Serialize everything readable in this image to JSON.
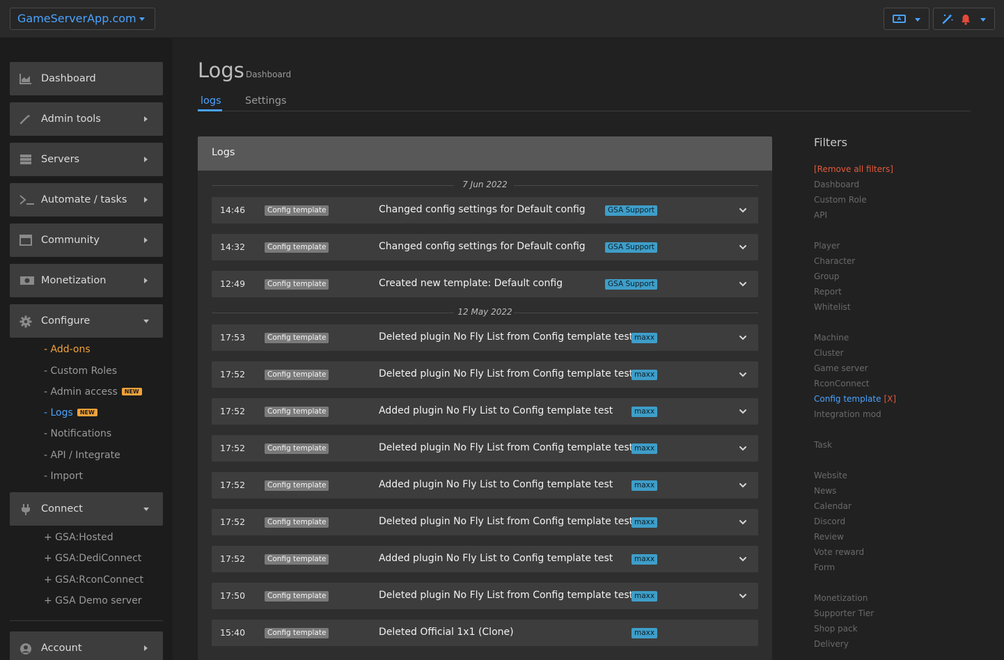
{
  "topbar": {
    "brand": "GameServerApp.com",
    "lang_icon_text": "A",
    "icons": [
      "language-icon",
      "magic-wand-icon",
      "bell-icon"
    ]
  },
  "sidebar": {
    "items": [
      {
        "label": "Dashboard",
        "icon": "chart-icon"
      },
      {
        "label": "Admin tools",
        "icon": "magic-wand-icon"
      },
      {
        "label": "Servers",
        "icon": "server-icon"
      },
      {
        "label": "Automate / tasks",
        "icon": "terminal-icon"
      },
      {
        "label": "Community",
        "icon": "window-icon"
      },
      {
        "label": "Monetization",
        "icon": "money-icon"
      },
      {
        "label": "Configure",
        "icon": "gear-icon"
      },
      {
        "label": "Connect",
        "icon": "plug-icon"
      },
      {
        "label": "Account",
        "icon": "user-icon"
      }
    ],
    "configure_sub": [
      {
        "label": "- Add-ons"
      },
      {
        "label": "- Custom Roles"
      },
      {
        "label": "- Admin access",
        "badge": "NEW"
      },
      {
        "label": "- Logs",
        "badge": "NEW"
      },
      {
        "label": "- Notifications"
      },
      {
        "label": "- API / Integrate"
      },
      {
        "label": "- Import"
      }
    ],
    "connect_sub": [
      {
        "label": "+ GSA:Hosted"
      },
      {
        "label": "+ GSA:DediConnect"
      },
      {
        "label": "+ GSA:RconConnect"
      },
      {
        "label": "+ GSA Demo server"
      }
    ]
  },
  "page": {
    "title": "Logs",
    "subtitle": "Dashboard",
    "tabs": [
      "logs",
      "Settings"
    ]
  },
  "logs": {
    "header": "Logs",
    "dates": [
      "7 Jun 2022",
      "12 May 2022"
    ],
    "rows": [
      {
        "time": "14:46",
        "category": "Config template",
        "message": "Changed config settings for Default config",
        "user": "GSA Support"
      },
      {
        "time": "14:32",
        "category": "Config template",
        "message": "Changed config settings for Default config",
        "user": "GSA Support"
      },
      {
        "time": "12:49",
        "category": "Config template",
        "message": "Created new template: Default config",
        "user": "GSA Support"
      },
      {
        "time": "17:53",
        "category": "Config template",
        "message": "Deleted plugin No Fly List from Config template test",
        "user": "maxx"
      },
      {
        "time": "17:52",
        "category": "Config template",
        "message": "Deleted plugin No Fly List from Config template test",
        "user": "maxx"
      },
      {
        "time": "17:52",
        "category": "Config template",
        "message": "Added plugin No Fly List to Config template test",
        "user": "maxx"
      },
      {
        "time": "17:52",
        "category": "Config template",
        "message": "Deleted plugin No Fly List from Config template test",
        "user": "maxx"
      },
      {
        "time": "17:52",
        "category": "Config template",
        "message": "Added plugin No Fly List to Config template test",
        "user": "maxx"
      },
      {
        "time": "17:52",
        "category": "Config template",
        "message": "Deleted plugin No Fly List from Config template test",
        "user": "maxx"
      },
      {
        "time": "17:52",
        "category": "Config template",
        "message": "Added plugin No Fly List to Config template test",
        "user": "maxx"
      },
      {
        "time": "17:50",
        "category": "Config template",
        "message": "Deleted plugin No Fly List from Config template test",
        "user": "maxx"
      },
      {
        "time": "15:40",
        "category": "Config template",
        "message": "Deleted Official 1x1 (Clone)",
        "user": "maxx"
      }
    ]
  },
  "filters": {
    "title": "Filters",
    "remove_all": "[Remove all filters]",
    "items": [
      "Dashboard",
      "Custom Role",
      "API",
      "Player",
      "Character",
      "Group",
      "Report",
      "Whitelist",
      "Machine",
      "Cluster",
      "Game server",
      "RconConnect",
      "Config template",
      "Integration mod",
      "Task",
      "Website",
      "News",
      "Calendar",
      "Discord",
      "Review",
      "Vote reward",
      "Form",
      "Monetization",
      "Supporter Tier",
      "Shop pack",
      "Delivery"
    ],
    "active_item": "Config template",
    "active_suffix": "[X]"
  },
  "colors": {
    "accent": "#4aa3ff",
    "orange": "#f0a23a",
    "remove": "#e25a3a",
    "user_badge": "#3e9ec9"
  }
}
